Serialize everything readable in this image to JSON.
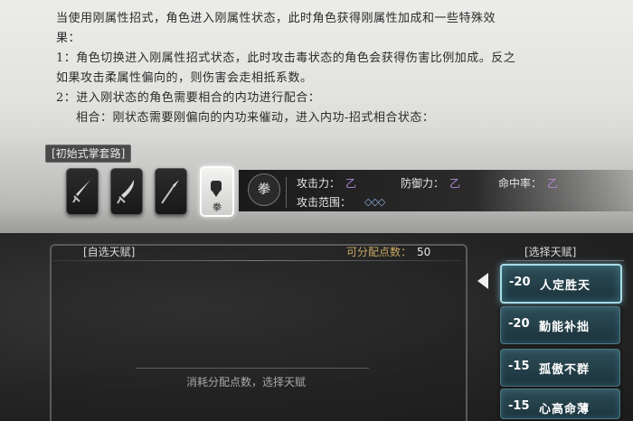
{
  "description": {
    "lines": [
      "当使用刚属性招式，角色进入刚属性状态，此时角色获得刚属性加成和一些特殊效",
      "果：",
      "1：角色切换进入刚属性招式状态，此时攻击毒状态的角色会获得伤害比例加成。反之",
      "如果攻击柔属性偏向的，则伤害会走相抵系数。",
      "2：进入刚状态的角色需要相合的内功进行配合：",
      "相合：刚状态需要刚偏向的内功来催动，进入内功-招式相合状态："
    ]
  },
  "style": {
    "tag": "[初始式掌套路]",
    "slots": [
      {
        "icon": "sword-icon",
        "selected": false
      },
      {
        "icon": "saber-icon",
        "selected": false
      },
      {
        "icon": "spear-icon",
        "selected": false
      },
      {
        "icon": "fist-icon",
        "selected": true,
        "label": "拳"
      }
    ],
    "badge": "拳",
    "stats": {
      "attack_label": "攻击力：",
      "attack_grade": "乙",
      "defense_label": "防御力：",
      "defense_grade": "乙",
      "hit_label": "命中率：",
      "hit_grade": "乙",
      "range_label": "攻击范围：",
      "range_value": "◇◇◇"
    },
    "grade_color": "#b48ad8"
  },
  "talent_panel": {
    "title": "[自选天赋]",
    "points_label": "可分配点数：",
    "points_value": "50",
    "hint": "消耗分配点数，选择天赋"
  },
  "select_panel": {
    "title": "[选择天赋]",
    "options": [
      {
        "cost": "-20",
        "name": "人定胜天",
        "active": true
      },
      {
        "cost": "-20",
        "name": "勤能补拙",
        "active": false
      },
      {
        "cost": "-15",
        "name": "孤傲不群",
        "active": false
      },
      {
        "cost": "-15",
        "name": "心高命薄",
        "active": false
      }
    ]
  }
}
